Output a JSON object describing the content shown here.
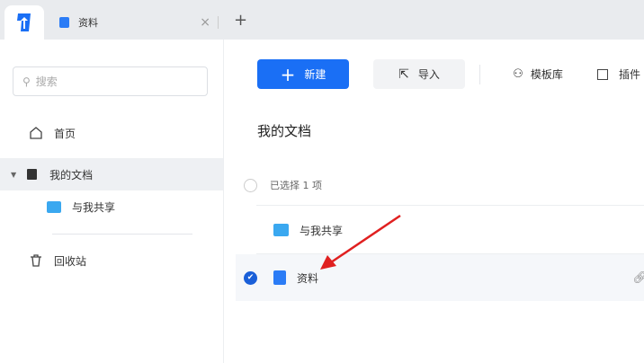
{
  "tabs": {
    "doc_tab": "资料",
    "close": "×",
    "new_tab": "+"
  },
  "sidebar": {
    "search_placeholder": "搜索",
    "items": [
      {
        "label": "首页"
      },
      {
        "label": "我的文档"
      },
      {
        "label": "与我共享"
      },
      {
        "label": "回收站"
      }
    ]
  },
  "toolbar": {
    "new_label": "新建",
    "import_label": "导入",
    "templates_label": "模板库",
    "plugins_label": "插件"
  },
  "main": {
    "title": "我的文档",
    "selection_status": "已选择 1 项",
    "files": [
      {
        "name": "与我共享",
        "type": "shared-folder",
        "selected": false
      },
      {
        "name": "资料",
        "type": "document",
        "selected": true
      }
    ]
  },
  "colors": {
    "accent": "#1a6ff5",
    "annotation_arrow": "#e02020"
  }
}
